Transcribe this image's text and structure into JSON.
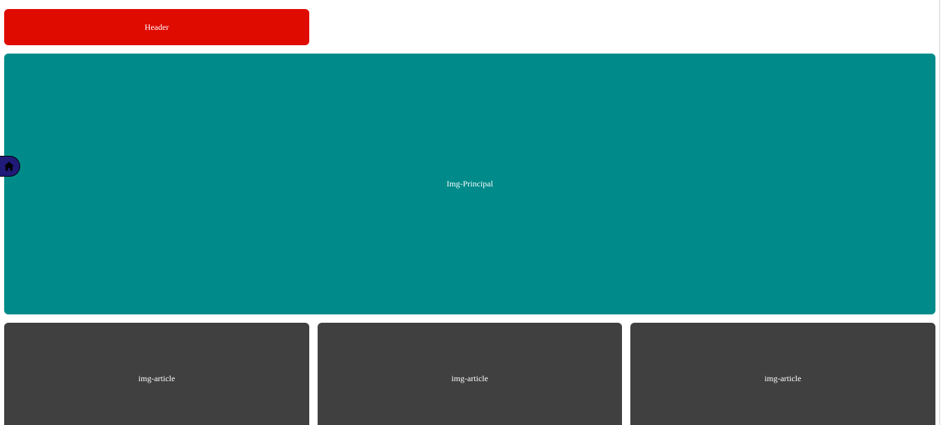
{
  "header": {
    "label": "Header",
    "color": "#df0a00"
  },
  "main_image": {
    "label": "Img-Principal",
    "color": "#008a8a"
  },
  "articles": [
    {
      "label": "img-article",
      "color": "#404040"
    },
    {
      "label": "img-article",
      "color": "#404040"
    },
    {
      "label": "img-article",
      "color": "#404040"
    }
  ],
  "home_button": {
    "icon": "home-icon",
    "background_color": "#201a78",
    "icon_color": "#000000"
  }
}
